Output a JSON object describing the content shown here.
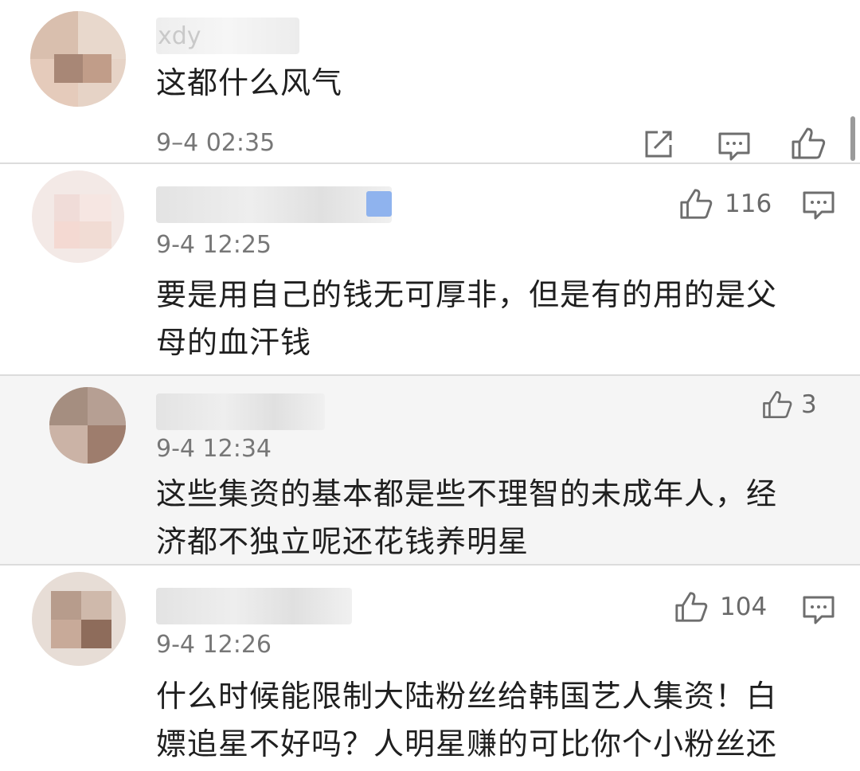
{
  "comments": [
    {
      "username": "xdy",
      "time": "9–4 02:35",
      "text": "这都什么风气",
      "actions": [
        "share-icon",
        "comment-icon",
        "like-icon"
      ]
    },
    {
      "time": "9-4 12:25",
      "likes": "116",
      "text": "要是用自己的钱无可厚非，但是有的用的是父\n母的血汗钱"
    },
    {
      "time": "9-4 12:34",
      "likes": "3",
      "text": "这些集资的基本都是些不理智的未成年人，经\n济都不独立呢还花钱养明星"
    },
    {
      "time": "9-4 12:26",
      "likes": "104",
      "text": "什么时候能限制大陆粉丝给韩国艺人集资！白\n嫖追星不好吗？人明星赚的可比你个小粉丝还"
    }
  ],
  "colors": {
    "divider": "#dcdcdc",
    "highlight_row": "#f5f5f5",
    "meta_text": "#777777",
    "icon": "#6e6e6e"
  }
}
